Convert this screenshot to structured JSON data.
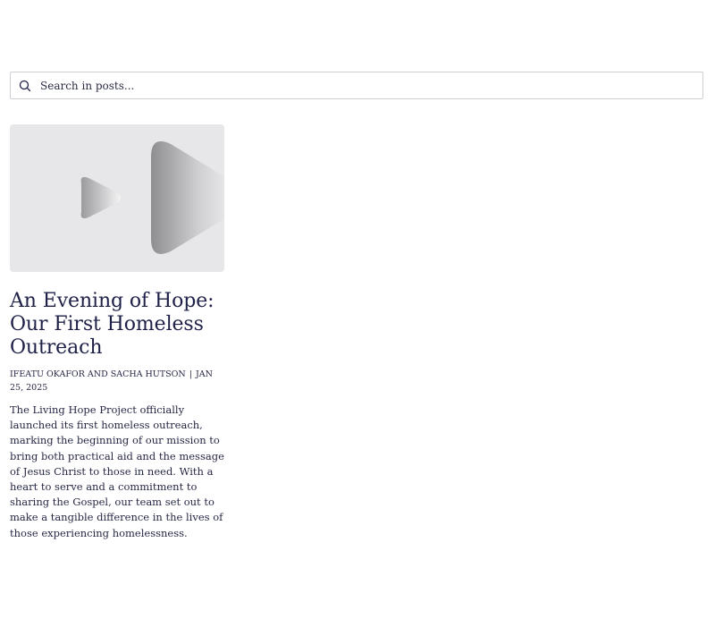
{
  "search": {
    "placeholder": "Search in posts..."
  },
  "posts": [
    {
      "thumbnail_icon": "play-icon",
      "title": "An Evening of Hope: Our First Homeless Outreach",
      "authors": "IFEATU OKAFOR AND SACHA HUTSON",
      "separator": "|",
      "date": "JAN 25, 2025",
      "excerpt": "The Living Hope Project officially launched its first homeless outreach, marking the beginning of our mission to bring both practical aid and the message of Jesus Christ to those in need. With a heart to serve and a commitment to sharing the Gospel, our team set out to make a tangible difference in the lives of those experiencing homelessness."
    }
  ],
  "colors": {
    "text": "#1e2048",
    "thumbnail_bg": "#e7e7e9",
    "border": "#cfd1d6"
  }
}
